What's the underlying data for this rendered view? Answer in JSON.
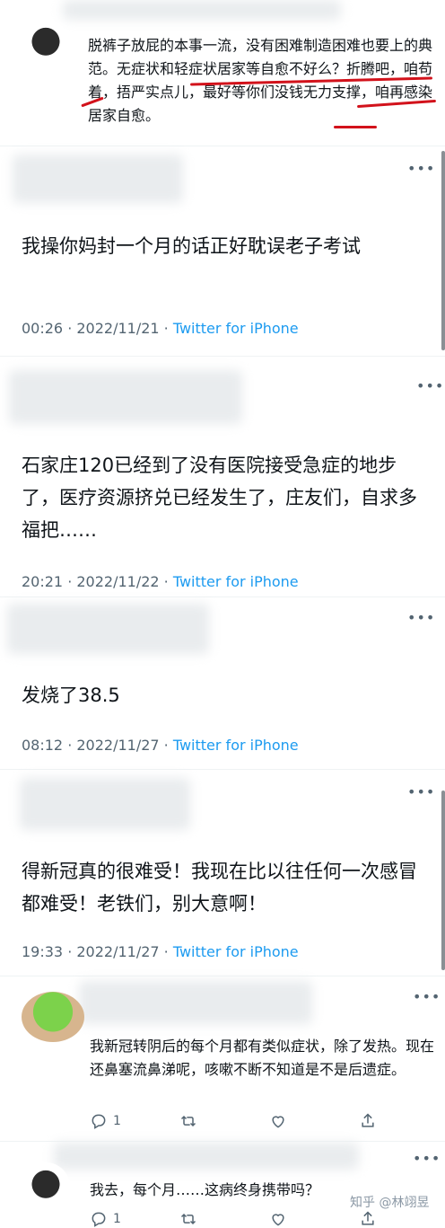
{
  "tweets": [
    {
      "text": "脱裤子放屁的本事一流，没有困难制造困难也要上的典范。无症状和轻症状居家等自愈不好么？折腾吧，咱苟着，捂严实点儿，最好等你们没钱无力支撑，咱再感染居家自愈。"
    },
    {
      "text": "我操你妈封一个月的话正好耽误老子考试",
      "time": "00:26 · 2022/11/21 · ",
      "source": "Twitter for iPhone"
    },
    {
      "text": "石家庄120已经到了没有医院接受急症的地步了，医疗资源挤兑已经发生了，庄友们，自求多福把……",
      "time": "20:21 · 2022/11/22 · ",
      "source": "Twitter for iPhone"
    },
    {
      "text": "发烧了38.5",
      "time": "08:12 · 2022/11/27 · ",
      "source": "Twitter for iPhone"
    },
    {
      "text": "得新冠真的很难受！我现在比以往任何一次感冒都难受！老铁们，别大意啊！",
      "time": "19:33 · 2022/11/27 · ",
      "source": "Twitter for iPhone"
    },
    {
      "text": "我新冠转阴后的每个月都有类似症状，除了发热。现在还鼻塞流鼻涕呢，咳嗽不断不知道是不是后遗症。",
      "reply_count": "1",
      "like_count": ""
    },
    {
      "text": "我去，每个月……这病终身携带吗？",
      "reply_count": "1"
    }
  ],
  "watermark": "知乎 @林翊昱",
  "colors": {
    "link": "#1d9bf0",
    "underline": "#d2121b",
    "muted": "#536471"
  },
  "icons": [
    "more-icon",
    "reply-icon",
    "retweet-icon",
    "like-icon",
    "share-icon"
  ]
}
